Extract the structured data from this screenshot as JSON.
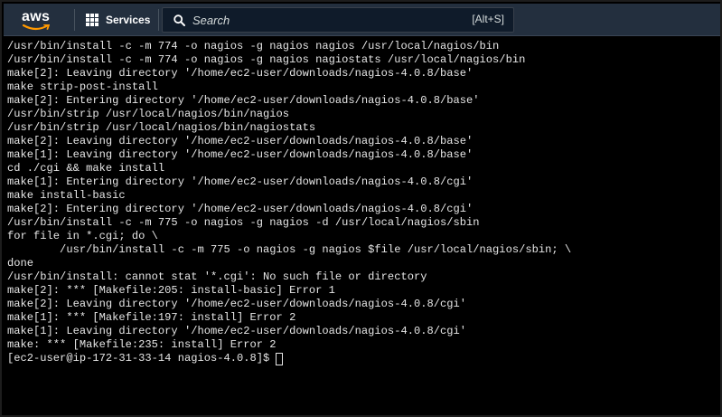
{
  "header": {
    "logo_text": "aws",
    "services_label": "Services",
    "search_placeholder": "Search",
    "search_shortcut": "[Alt+S]"
  },
  "terminal": {
    "lines": [
      "/usr/bin/install -c -m 774 -o nagios -g nagios nagios /usr/local/nagios/bin",
      "/usr/bin/install -c -m 774 -o nagios -g nagios nagiostats /usr/local/nagios/bin",
      "make[2]: Leaving directory '/home/ec2-user/downloads/nagios-4.0.8/base'",
      "make strip-post-install",
      "make[2]: Entering directory '/home/ec2-user/downloads/nagios-4.0.8/base'",
      "/usr/bin/strip /usr/local/nagios/bin/nagios",
      "/usr/bin/strip /usr/local/nagios/bin/nagiostats",
      "make[2]: Leaving directory '/home/ec2-user/downloads/nagios-4.0.8/base'",
      "make[1]: Leaving directory '/home/ec2-user/downloads/nagios-4.0.8/base'",
      "cd ./cgi && make install",
      "make[1]: Entering directory '/home/ec2-user/downloads/nagios-4.0.8/cgi'",
      "make install-basic",
      "make[2]: Entering directory '/home/ec2-user/downloads/nagios-4.0.8/cgi'",
      "/usr/bin/install -c -m 775 -o nagios -g nagios -d /usr/local/nagios/sbin",
      "for file in *.cgi; do \\",
      "        /usr/bin/install -c -m 775 -o nagios -g nagios $file /usr/local/nagios/sbin; \\",
      "done",
      "/usr/bin/install: cannot stat '*.cgi': No such file or directory",
      "make[2]: *** [Makefile:205: install-basic] Error 1",
      "make[2]: Leaving directory '/home/ec2-user/downloads/nagios-4.0.8/cgi'",
      "make[1]: *** [Makefile:197: install] Error 2",
      "make[1]: Leaving directory '/home/ec2-user/downloads/nagios-4.0.8/cgi'",
      "make: *** [Makefile:235: install] Error 2"
    ],
    "prompt": "[ec2-user@ip-172-31-33-14 nagios-4.0.8]$"
  },
  "colors": {
    "header_bg": "#232f3e",
    "terminal_bg": "#000000",
    "terminal_text": "#e6e6e6",
    "aws_smile": "#ff9900"
  }
}
